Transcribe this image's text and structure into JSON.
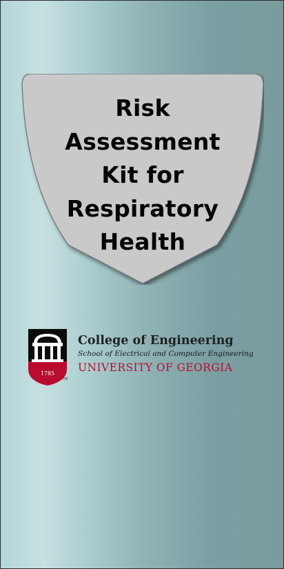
{
  "cover": {
    "title": "Risk Assessment Kit for Respiratory Health"
  },
  "logo": {
    "year": "1785",
    "trademark": "TM",
    "college": "College of Engineering",
    "school": "School of Electrical and Computer Engineering",
    "university": "UNIVERSITY OF GEORGIA",
    "colors": {
      "red": "#ba0c2f",
      "black": "#000000"
    }
  }
}
